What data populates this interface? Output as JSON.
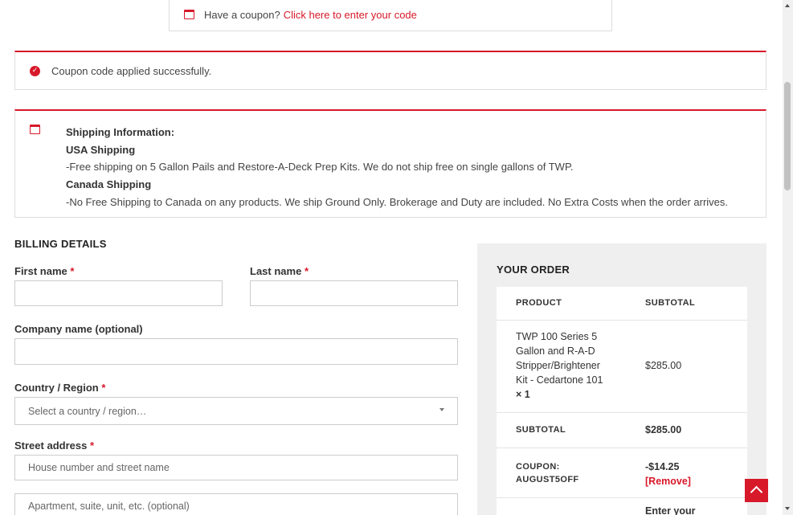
{
  "coupon_prompt": {
    "text": "Have a coupon?",
    "link": "Click here to enter your code"
  },
  "success_notice": {
    "message": "Coupon code applied successfully."
  },
  "shipping_info": {
    "heading": "Shipping Information:",
    "usa_heading": "USA Shipping",
    "usa_text": "-Free shipping on 5 Gallon Pails and Restore-A-Deck Prep Kits. We do not ship free on single gallons of TWP.",
    "canada_heading": "Canada Shipping",
    "canada_text": "-No Free Shipping to Canada on any products. We ship Ground Only. Brokerage and Duty are included. No Extra Costs when the order arrives."
  },
  "billing": {
    "title": "BILLING DETAILS",
    "required_mark": "*",
    "first_name_label": "First name",
    "last_name_label": "Last name",
    "company_label": "Company name (optional)",
    "country_label": "Country / Region",
    "country_placeholder": "Select a country / region…",
    "street_label": "Street address",
    "street_placeholder": "House number and street name",
    "street2_placeholder": "Apartment, suite, unit, etc. (optional)"
  },
  "order": {
    "title": "YOUR ORDER",
    "col_product": "PRODUCT",
    "col_subtotal": "SUBTOTAL",
    "item_name_lines": [
      "TWP 100 Series 5",
      "Gallon and R-A-D",
      "Stripper/Brightener",
      "Kit - Cedartone 101"
    ],
    "item_qty": "× 1",
    "item_price": "$285.00",
    "subtotal_label": "SUBTOTAL",
    "subtotal_value": "$285.00",
    "coupon_label_line1": "COUPON:",
    "coupon_label_line2": "AUGUST5OFF",
    "coupon_value": "-$14.25",
    "remove_label": "[Remove]",
    "next_row_partial": "Enter your"
  },
  "icons": {
    "coupon": "calendar-icon",
    "success": "check-circle-icon",
    "shipping": "calendar-icon",
    "back_to_top": "chevron-up-icon",
    "select": "caret-down-icon"
  },
  "colors": {
    "accent": "#d7192a",
    "panel_bg": "#efefef",
    "border": "#dddddd"
  }
}
